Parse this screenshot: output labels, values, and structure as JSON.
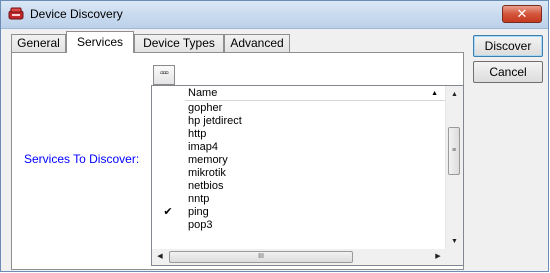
{
  "window": {
    "title": "Device Discovery",
    "close_glyph": "✕",
    "accent": "#c43a20"
  },
  "tabs": [
    {
      "label": "General",
      "active": false
    },
    {
      "label": "Services",
      "active": true
    },
    {
      "label": "Device Types",
      "active": false
    },
    {
      "label": "Advanced",
      "active": false
    }
  ],
  "buttons": {
    "discover": "Discover",
    "cancel": "Cancel",
    "ellipsis": "▫▫▫"
  },
  "services": {
    "label": "Services To Discover:",
    "label_color": "#0000ff",
    "column_header": "Name",
    "items": [
      {
        "name": "gopher",
        "checked": false
      },
      {
        "name": "hp jetdirect",
        "checked": false
      },
      {
        "name": "http",
        "checked": false
      },
      {
        "name": "imap4",
        "checked": false
      },
      {
        "name": "memory",
        "checked": false
      },
      {
        "name": "mikrotik",
        "checked": false
      },
      {
        "name": "netbios",
        "checked": false
      },
      {
        "name": "nntp",
        "checked": false
      },
      {
        "name": "ping",
        "checked": true
      },
      {
        "name": "pop3",
        "checked": false
      }
    ],
    "check_glyph": "✔"
  },
  "icons": {
    "app": "device-discovery-icon",
    "scroll_up": "▲",
    "scroll_down": "▼",
    "scroll_left": "◀",
    "scroll_right": "▶",
    "vgrip": "≡",
    "hgrip": "III"
  }
}
